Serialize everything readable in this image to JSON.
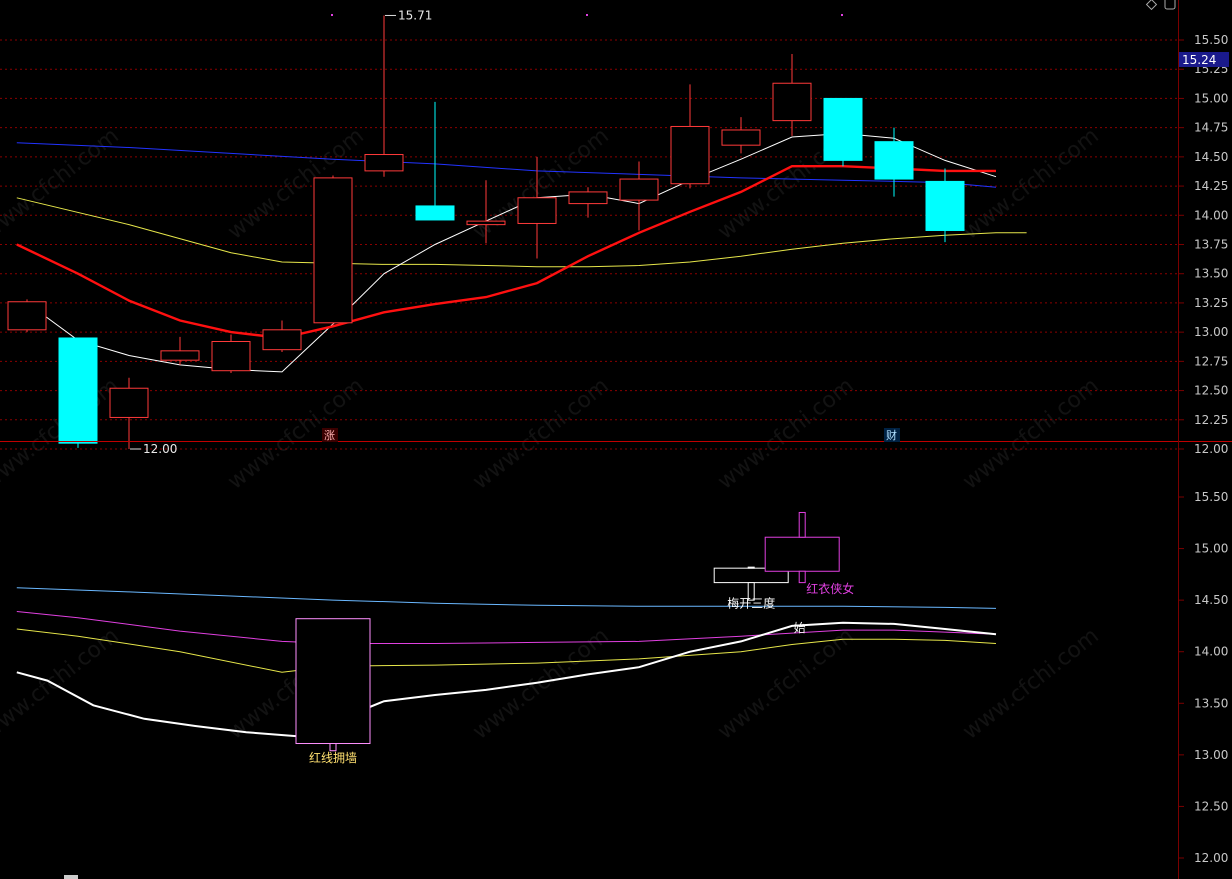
{
  "watermark": "www.cfchi.com",
  "current_price_label": "15.24",
  "markers": {
    "top": "涨",
    "bottom": "财"
  },
  "colors": {
    "up": "#ff3a3a",
    "down": "#00ffff",
    "grid": "#8a0000",
    "axis_line": "#7a0000",
    "ma_fast": "#ffffff",
    "ma_mid": "#ff1010",
    "ma_slow": "#e6e64a",
    "ma_long": "#2233ff",
    "price_box_bg": "#1a1a8c",
    "lower_white": "#ffffff",
    "lower_pink": "#e040e0",
    "lower_yellow": "#e6e64a",
    "lower_blue": "#6ab8ff",
    "hongxian": "#ffe070",
    "meikai": "#ffffff",
    "hongyi": "#e040e0"
  },
  "chart_data": [
    {
      "type": "candlestick",
      "panel": "upper",
      "ylim": [
        11.85,
        15.85
      ],
      "yticks": [
        "12.00",
        "12.25",
        "12.50",
        "12.75",
        "13.00",
        "13.25",
        "13.50",
        "13.75",
        "14.00",
        "14.25",
        "14.50",
        "14.75",
        "15.00",
        "15.25",
        "15.50"
      ],
      "grid": true,
      "candles": [
        {
          "open": 13.02,
          "close": 13.26,
          "high": 13.28,
          "low": 13.0
        },
        {
          "open": 12.95,
          "close": 12.05,
          "high": 12.95,
          "low": 12.01
        },
        {
          "open": 12.27,
          "close": 12.52,
          "high": 12.61,
          "low": 12.0
        },
        {
          "open": 12.76,
          "close": 12.84,
          "high": 12.96,
          "low": 12.72
        },
        {
          "open": 12.67,
          "close": 12.92,
          "high": 12.98,
          "low": 12.65
        },
        {
          "open": 12.85,
          "close": 13.02,
          "high": 13.1,
          "low": 12.83
        },
        {
          "open": 13.08,
          "close": 14.32,
          "high": 14.34,
          "low": 13.06
        },
        {
          "open": 14.38,
          "close": 14.52,
          "high": 15.71,
          "low": 14.33
        },
        {
          "open": 14.08,
          "close": 13.96,
          "high": 14.97,
          "low": 13.96
        },
        {
          "open": 13.92,
          "close": 13.95,
          "high": 14.3,
          "low": 13.76
        },
        {
          "open": 13.93,
          "close": 14.15,
          "high": 14.5,
          "low": 13.63
        },
        {
          "open": 14.1,
          "close": 14.2,
          "high": 14.24,
          "low": 13.98
        },
        {
          "open": 14.13,
          "close": 14.31,
          "high": 14.46,
          "low": 13.87
        },
        {
          "open": 14.27,
          "close": 14.76,
          "high": 15.12,
          "low": 14.23
        },
        {
          "open": 14.6,
          "close": 14.73,
          "high": 14.84,
          "low": 14.53
        },
        {
          "open": 14.81,
          "close": 15.13,
          "high": 15.38,
          "low": 14.68
        },
        {
          "open": 15.0,
          "close": 14.47,
          "high": 15.0,
          "low": 14.42
        },
        {
          "open": 14.63,
          "close": 14.31,
          "high": 14.75,
          "low": 14.16
        },
        {
          "open": 14.29,
          "close": 13.87,
          "high": 14.4,
          "low": 13.77
        }
      ],
      "annotations": [
        {
          "text": "15.71",
          "candle": 7,
          "price": 15.71,
          "side": "right"
        },
        {
          "text": "12.00",
          "candle": 2,
          "price": 12.0,
          "side": "right"
        }
      ],
      "lines": [
        {
          "name": "",
          "color": "#ffffff",
          "width": 1,
          "points": [
            [
              0,
              13.25
            ],
            [
              1,
              12.93
            ],
            [
              2,
              12.8
            ],
            [
              3,
              12.72
            ],
            [
              4,
              12.68
            ],
            [
              5,
              12.66
            ],
            [
              6,
              13.07
            ],
            [
              7,
              13.5
            ],
            [
              8,
              13.75
            ],
            [
              9,
              13.95
            ],
            [
              10,
              14.15
            ],
            [
              11,
              14.18
            ],
            [
              12,
              14.1
            ],
            [
              13,
              14.3
            ],
            [
              14,
              14.48
            ],
            [
              15,
              14.67
            ],
            [
              16,
              14.7
            ],
            [
              17,
              14.66
            ],
            [
              18,
              14.47
            ],
            [
              19,
              14.33
            ]
          ]
        },
        {
          "name": "",
          "color": "#ff1010",
          "width": 2.4,
          "points": [
            [
              -0.2,
              13.75
            ],
            [
              1,
              13.5
            ],
            [
              2,
              13.27
            ],
            [
              3,
              13.1
            ],
            [
              4,
              13.0
            ],
            [
              5,
              12.95
            ],
            [
              6,
              13.05
            ],
            [
              7,
              13.17
            ],
            [
              8,
              13.24
            ],
            [
              9,
              13.3
            ],
            [
              10,
              13.42
            ],
            [
              11,
              13.65
            ],
            [
              12,
              13.85
            ],
            [
              13,
              14.03
            ],
            [
              14,
              14.2
            ],
            [
              15,
              14.42
            ],
            [
              16,
              14.42
            ],
            [
              17,
              14.4
            ],
            [
              18,
              14.38
            ],
            [
              19,
              14.38
            ]
          ]
        },
        {
          "name": "",
          "color": "#e6e64a",
          "width": 1,
          "points": [
            [
              -0.2,
              14.15
            ],
            [
              2,
              13.92
            ],
            [
              4,
              13.68
            ],
            [
              5,
              13.6
            ],
            [
              6,
              13.59
            ],
            [
              7,
              13.58
            ],
            [
              8,
              13.58
            ],
            [
              9,
              13.57
            ],
            [
              10,
              13.56
            ],
            [
              11,
              13.56
            ],
            [
              12,
              13.57
            ],
            [
              13,
              13.6
            ],
            [
              14,
              13.65
            ],
            [
              15,
              13.71
            ],
            [
              16,
              13.76
            ],
            [
              17,
              13.8
            ],
            [
              18,
              13.83
            ],
            [
              19,
              13.85
            ],
            [
              19.6,
              13.85
            ]
          ]
        },
        {
          "name": "",
          "color": "#2233ff",
          "width": 1,
          "points": [
            [
              -0.2,
              14.62
            ],
            [
              2,
              14.58
            ],
            [
              4,
              14.53
            ],
            [
              6,
              14.48
            ],
            [
              8,
              14.44
            ],
            [
              10,
              14.38
            ],
            [
              12,
              14.35
            ],
            [
              14,
              14.32
            ],
            [
              16,
              14.3
            ],
            [
              18,
              14.28
            ],
            [
              19,
              14.24
            ]
          ]
        }
      ]
    },
    {
      "type": "candlestick",
      "panel": "lower",
      "ylim": [
        11.85,
        15.85
      ],
      "yticks": [
        "12.00",
        "12.50",
        "13.00",
        "13.50",
        "14.00",
        "14.50",
        "15.00",
        "15.50"
      ],
      "grid": false,
      "candles": [
        {
          "open": 13.11,
          "close": 14.32,
          "high": 14.32,
          "low": 13.04,
          "color": "#ff90ff",
          "fill": "#000000",
          "x": 6
        },
        {
          "open": 14.67,
          "close": 14.81,
          "high": 14.82,
          "low": 14.5,
          "color": "#ffffff",
          "fill": "#000000",
          "x": 14.2
        },
        {
          "open": 14.78,
          "close": 15.11,
          "high": 15.35,
          "low": 14.67,
          "color": "#e040e0",
          "fill": "#000000",
          "x": 15.2
        }
      ],
      "labels": [
        {
          "text": "红线拥墙",
          "x": 6,
          "price": 12.93,
          "color": "#ffe070"
        },
        {
          "text": "梅开三度",
          "x": 14.2,
          "price": 14.43,
          "color": "#ffffff"
        },
        {
          "text": "红衣侠女",
          "x": 15.75,
          "price": 14.57,
          "color": "#e040e0"
        },
        {
          "text": "始",
          "x": 15.15,
          "price": 14.19,
          "color": "#ffffff"
        }
      ],
      "lines": [
        {
          "name": "",
          "color": "#ffffff",
          "width": 2,
          "points": [
            [
              -0.2,
              13.8
            ],
            [
              0.4,
              13.72
            ],
            [
              1.3,
              13.48
            ],
            [
              2.3,
              13.35
            ],
            [
              3.3,
              13.28
            ],
            [
              4.3,
              13.22
            ],
            [
              5.3,
              13.18
            ],
            [
              5.6,
              13.22
            ],
            [
              6,
              13.32
            ],
            [
              7,
              13.52
            ],
            [
              8,
              13.58
            ],
            [
              9,
              13.63
            ],
            [
              10,
              13.7
            ],
            [
              11,
              13.78
            ],
            [
              12,
              13.85
            ],
            [
              13,
              14.0
            ],
            [
              14,
              14.1
            ],
            [
              15,
              14.25
            ],
            [
              16,
              14.28
            ],
            [
              17,
              14.27
            ],
            [
              18,
              14.22
            ],
            [
              19,
              14.17
            ]
          ]
        },
        {
          "name": "",
          "color": "#e040e0",
          "width": 1,
          "points": [
            [
              -0.2,
              14.39
            ],
            [
              1,
              14.33
            ],
            [
              3,
              14.2
            ],
            [
              5,
              14.1
            ],
            [
              6,
              14.08
            ],
            [
              8,
              14.08
            ],
            [
              10,
              14.09
            ],
            [
              12,
              14.1
            ],
            [
              14,
              14.15
            ],
            [
              15,
              14.18
            ],
            [
              16,
              14.21
            ],
            [
              17,
              14.21
            ],
            [
              18,
              14.19
            ],
            [
              19,
              14.17
            ]
          ]
        },
        {
          "name": "",
          "color": "#e6e64a",
          "width": 1,
          "points": [
            [
              -0.2,
              14.22
            ],
            [
              1,
              14.15
            ],
            [
              3,
              14.0
            ],
            [
              5,
              13.8
            ],
            [
              6,
              13.86
            ],
            [
              8,
              13.87
            ],
            [
              10,
              13.89
            ],
            [
              12,
              13.93
            ],
            [
              14,
              14.0
            ],
            [
              15,
              14.07
            ],
            [
              16,
              14.12
            ],
            [
              17,
              14.12
            ],
            [
              18,
              14.11
            ],
            [
              19,
              14.08
            ]
          ]
        },
        {
          "name": "",
          "color": "#6ab8ff",
          "width": 1,
          "points": [
            [
              -0.2,
              14.62
            ],
            [
              2,
              14.58
            ],
            [
              4,
              14.54
            ],
            [
              6,
              14.5
            ],
            [
              8,
              14.47
            ],
            [
              10,
              14.45
            ],
            [
              12,
              14.44
            ],
            [
              14,
              14.44
            ],
            [
              16,
              14.44
            ],
            [
              18,
              14.43
            ],
            [
              19,
              14.42
            ]
          ]
        }
      ]
    }
  ]
}
